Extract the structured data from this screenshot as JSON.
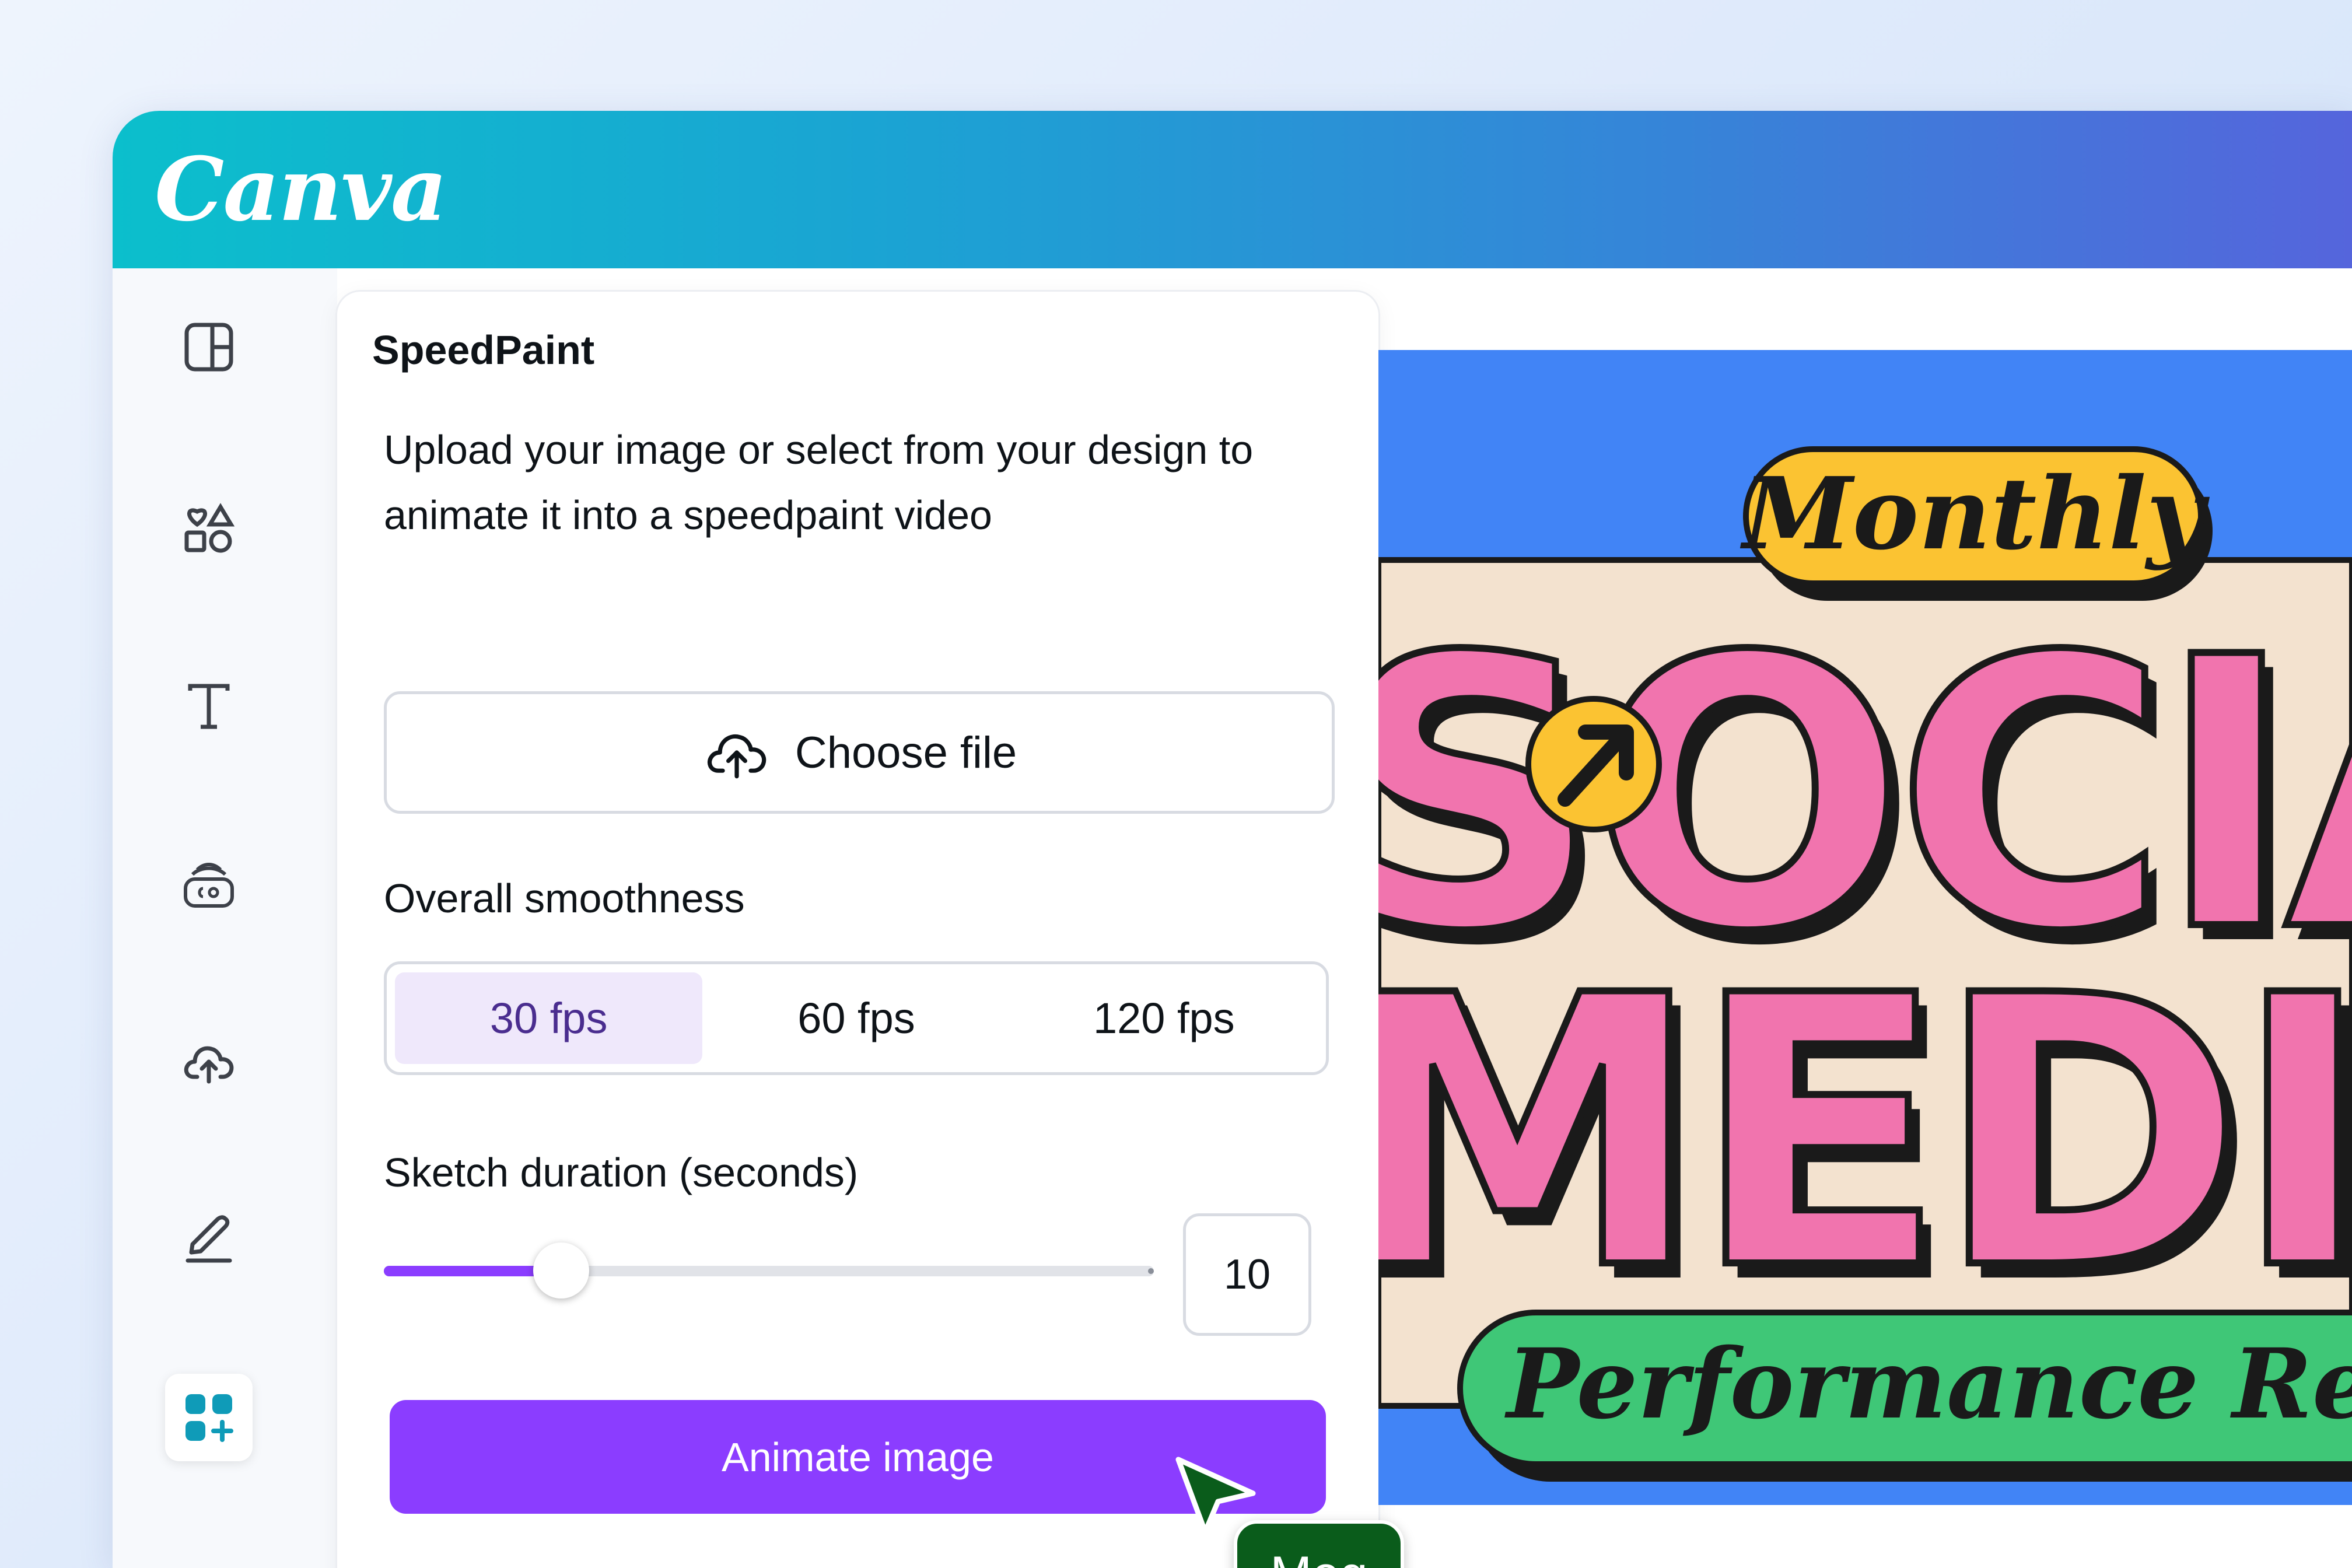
{
  "app": {
    "logo_text": "Canva"
  },
  "sidebar": {
    "items": [
      {
        "icon": "layout-icon",
        "active": false
      },
      {
        "icon": "elements-icon",
        "active": false
      },
      {
        "icon": "text-icon",
        "active": false
      },
      {
        "icon": "brand-icon",
        "active": false
      },
      {
        "icon": "upload-icon",
        "active": false
      },
      {
        "icon": "draw-icon",
        "active": false
      },
      {
        "icon": "apps-icon",
        "active": true
      }
    ]
  },
  "panel": {
    "title": "SpeedPaint",
    "description": "Upload your image or select from your design to animate it into a speedpaint video",
    "choose_file_label": "Choose file",
    "smoothness_label": "Overall smoothness",
    "fps_options": [
      "30 fps",
      "60 fps",
      "120 fps"
    ],
    "fps_selected": "30 fps",
    "duration_label": "Sketch duration (seconds)",
    "duration_value": "10",
    "duration_fraction": 0.23,
    "animate_label": "Animate image"
  },
  "collaborator": {
    "name": "Meg",
    "color": "#0a5c1b"
  },
  "design": {
    "badge_top": "Monthly",
    "title_line1": "SOCIA",
    "title_line2": "MEDIA",
    "badge_bottom": "Performance Repor"
  },
  "colors": {
    "accent": "#8b3dff",
    "selected_bg": "#efe8fb",
    "canvas_bg": "#4184f6",
    "design_pink": "#f174ae",
    "design_yellow": "#fbc332",
    "design_green": "#3fc777",
    "design_cream": "#f3e2cf"
  }
}
